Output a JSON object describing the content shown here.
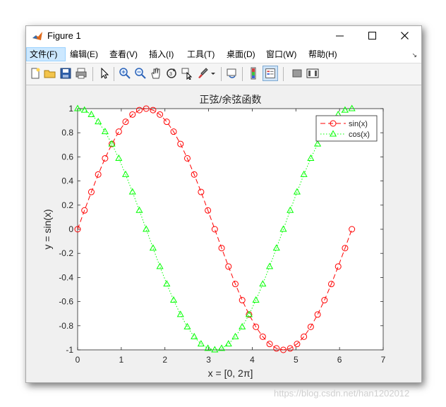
{
  "window": {
    "title": "Figure 1"
  },
  "menu": {
    "items": [
      {
        "label": "文件(F)"
      },
      {
        "label": "编辑(E)"
      },
      {
        "label": "查看(V)"
      },
      {
        "label": "插入(I)"
      },
      {
        "label": "工具(T)"
      },
      {
        "label": "桌面(D)"
      },
      {
        "label": "窗口(W)"
      },
      {
        "label": "帮助(H)"
      }
    ],
    "overflow": "↘"
  },
  "toolbar": {
    "icons": [
      "new-figure-icon",
      "open-file-icon",
      "save-icon",
      "print-icon",
      "select-arrow-icon",
      "zoom-in-icon",
      "zoom-out-icon",
      "pan-hand-icon",
      "rotate-3d-icon",
      "data-cursor-icon",
      "brush-icon",
      "dropdown-arrow-icon",
      "link-plot-icon",
      "colorbar-icon",
      "legend-icon",
      "hide-plot-tools-icon",
      "show-plot-tools-icon"
    ]
  },
  "chart_data": {
    "type": "line",
    "title": "正弦/余弦函数",
    "xlabel": "x = [0, 2π]",
    "ylabel": "y = sin(x)",
    "xlim": [
      0,
      7
    ],
    "ylim": [
      -1,
      1
    ],
    "xticks": [
      "0",
      "1",
      "2",
      "3",
      "4",
      "5",
      "6",
      "7"
    ],
    "yticks": [
      "-1",
      "-0.8",
      "-0.6",
      "-0.4",
      "-0.2",
      "0",
      "0.2",
      "0.4",
      "0.6",
      "0.8",
      "1"
    ],
    "grid": false,
    "legend_position": "top-right",
    "series": [
      {
        "name": "sin(x)",
        "color": "#ff0000",
        "line": "dashed",
        "marker": "circle",
        "x": [
          0,
          0.1571,
          0.3142,
          0.4712,
          0.6283,
          0.7854,
          0.9425,
          1.0996,
          1.2566,
          1.4137,
          1.5708,
          1.7279,
          1.885,
          2.042,
          2.1991,
          2.3562,
          2.5133,
          2.6704,
          2.8274,
          2.9845,
          3.1416,
          3.2987,
          3.4558,
          3.6128,
          3.7699,
          3.927,
          4.0841,
          4.2412,
          4.3982,
          4.5553,
          4.7124,
          4.8695,
          5.0265,
          5.1836,
          5.3407,
          5.4978,
          5.6549,
          5.8119,
          5.969,
          6.1261,
          6.2832
        ],
        "y": [
          0,
          0.1564,
          0.309,
          0.454,
          0.5878,
          0.7071,
          0.809,
          0.891,
          0.9511,
          0.9877,
          1,
          0.9877,
          0.9511,
          0.891,
          0.809,
          0.7071,
          0.5878,
          0.454,
          0.309,
          0.1564,
          0,
          -0.1564,
          -0.309,
          -0.454,
          -0.5878,
          -0.7071,
          -0.809,
          -0.891,
          -0.9511,
          -0.9877,
          -1,
          -0.9877,
          -0.9511,
          -0.891,
          -0.809,
          -0.7071,
          -0.5878,
          -0.454,
          -0.309,
          -0.1564,
          0
        ]
      },
      {
        "name": "cos(x)",
        "color": "#00ff00",
        "line": "dotted",
        "marker": "triangle",
        "x": [
          0,
          0.1571,
          0.3142,
          0.4712,
          0.6283,
          0.7854,
          0.9425,
          1.0996,
          1.2566,
          1.4137,
          1.5708,
          1.7279,
          1.885,
          2.042,
          2.1991,
          2.3562,
          2.5133,
          2.6704,
          2.8274,
          2.9845,
          3.1416,
          3.2987,
          3.4558,
          3.6128,
          3.7699,
          3.927,
          4.0841,
          4.2412,
          4.3982,
          4.5553,
          4.7124,
          4.8695,
          5.0265,
          5.1836,
          5.3407,
          5.4978,
          5.6549,
          5.8119,
          5.969,
          6.1261,
          6.2832
        ],
        "y": [
          1,
          0.9877,
          0.9511,
          0.891,
          0.809,
          0.7071,
          0.5878,
          0.454,
          0.309,
          0.1564,
          0,
          -0.1564,
          -0.309,
          -0.454,
          -0.5878,
          -0.7071,
          -0.809,
          -0.891,
          -0.9511,
          -0.9877,
          -1,
          -0.9877,
          -0.9511,
          -0.891,
          -0.809,
          -0.7071,
          -0.5878,
          -0.454,
          -0.309,
          -0.1564,
          0,
          0.1564,
          0.309,
          0.454,
          0.5878,
          0.7071,
          0.809,
          0.891,
          0.9511,
          0.9877,
          1
        ]
      }
    ]
  },
  "watermark": "https://blog.csdn.net/han1202012"
}
